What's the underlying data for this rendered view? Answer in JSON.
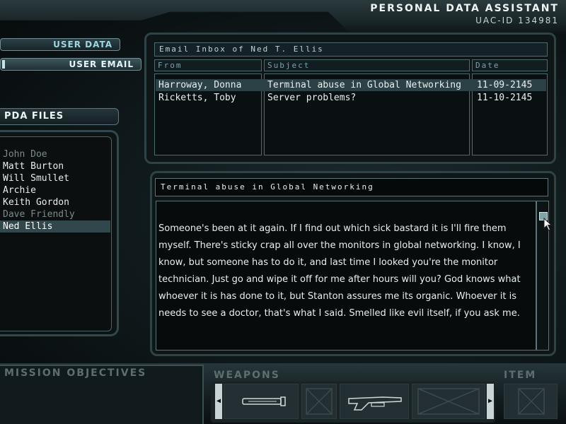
{
  "header": {
    "title": "PERSONAL DATA ASSISTANT",
    "uac_id": "UAC-ID 134981"
  },
  "tabs": {
    "user_data": "USER DATA",
    "user_email": "USER EMAIL"
  },
  "pda_files": {
    "heading": "PDA FILES",
    "items": [
      {
        "name": "John Doe",
        "state": "dim"
      },
      {
        "name": "Matt Burton",
        "state": "normal"
      },
      {
        "name": "Will Smullet",
        "state": "normal"
      },
      {
        "name": "Archie",
        "state": "normal"
      },
      {
        "name": "Keith Gordon",
        "state": "normal"
      },
      {
        "name": "Dave Friendly",
        "state": "dim"
      },
      {
        "name": "Ned Ellis",
        "state": "selected"
      }
    ]
  },
  "inbox": {
    "title": "Email Inbox of Ned T. Ellis",
    "columns": {
      "from": "From",
      "subject": "Subject",
      "date": "Date"
    },
    "emails": [
      {
        "from": "Harroway, Donna",
        "subject": "Terminal abuse in Global Networking",
        "date": "11-09-2145"
      },
      {
        "from": "Ricketts, Toby",
        "subject": "Server problems?",
        "date": "11-10-2145"
      }
    ]
  },
  "message": {
    "subject": "Terminal abuse in Global Networking",
    "body": "Someone's been at it again. If I find out which sick bastard it is I'll fire them myself. There's sticky crap all over the monitors in global networking. I know, I know, but someone has to do it, and last time I looked you're the monitor technician. Just go and wipe it off for me after hours will you? God knows what whoever it is has done to it, but Stanton assures me its organic. Whoever it is needs to see a doctor, that's what I said. Smelled like evil itself, if you ask me."
  },
  "bottom": {
    "mission_objectives": "MISSION OBJECTIVES",
    "weapons": "WEAPONS",
    "item": "ITEM",
    "weapon_slots": [
      "flashlight-icon",
      "empty-slot-icon",
      "shotgun-icon",
      "empty-slot-icon"
    ]
  },
  "colors": {
    "accent": "#9fd6e0",
    "selection": "#2b4145"
  }
}
